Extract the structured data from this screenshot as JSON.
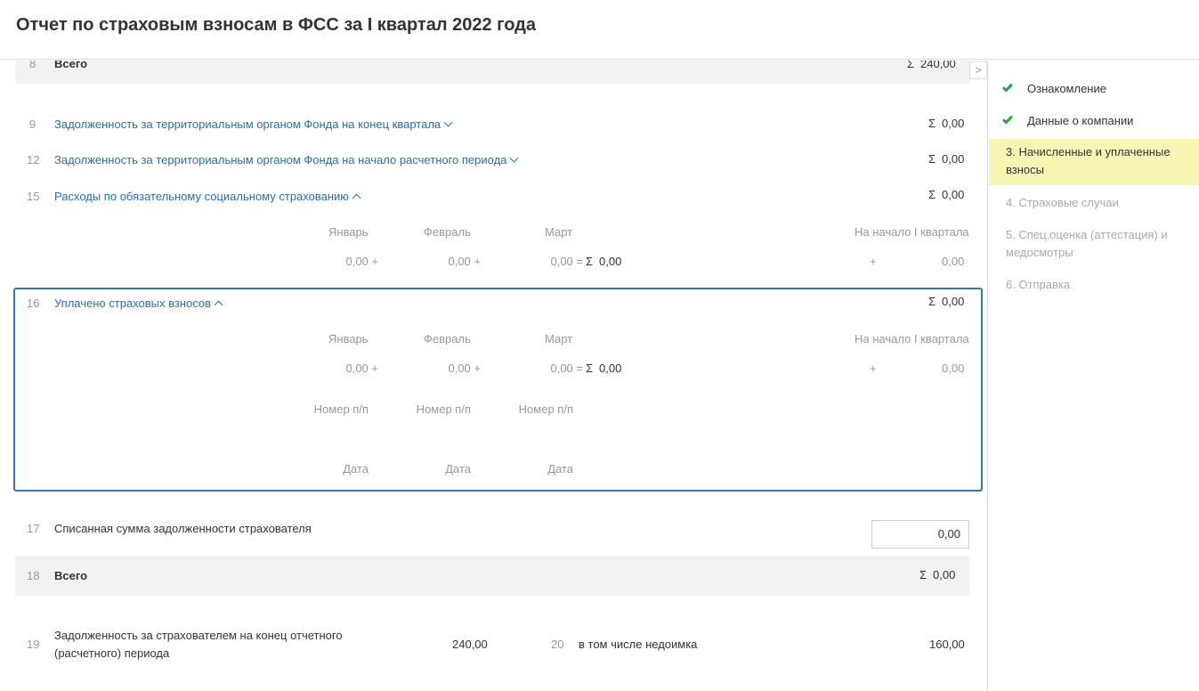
{
  "header": {
    "title": "Отчет по страховым взносам в ФСС за I квартал 2022 года"
  },
  "rows": {
    "r8": {
      "num": "8",
      "label": "Всего",
      "sigma": "Σ",
      "value": "240,00"
    },
    "r9": {
      "num": "9",
      "label": "Задолженность за территориальным органом Фонда на конец квартала",
      "sigma": "Σ",
      "value": "0,00"
    },
    "r12": {
      "num": "12",
      "label": "Задолженность за территориальным органом Фонда на начало расчетного периода",
      "sigma": "Σ",
      "value": "0,00"
    },
    "r15": {
      "num": "15",
      "label": "Расходы по обязательному социальному страхованию",
      "sigma": "Σ",
      "value": "0,00",
      "months": [
        "Январь",
        "Февраль",
        "Март"
      ],
      "start_label": "На начало I квартала",
      "jan": "0,00 +",
      "feb": "0,00 +",
      "mar": "0,00 =",
      "total_sigma": "Σ",
      "total": "0,00",
      "plus": "+",
      "start_value": "0,00"
    },
    "r16": {
      "num": "16",
      "label": "Уплачено страховых взносов",
      "sigma": "Σ",
      "value": "0,00",
      "months": [
        "Январь",
        "Февраль",
        "Март"
      ],
      "start_label": "На начало I квартала",
      "jan": "0,00 +",
      "feb": "0,00 +",
      "mar": "0,00 =",
      "total_sigma": "Σ",
      "total": "0,00",
      "plus": "+",
      "start_value": "0,00",
      "doc_num_label": "Номер п/п",
      "date_label": "Дата"
    },
    "r17": {
      "num": "17",
      "label": "Списанная сумма задолженности страхователя",
      "value": "0,00"
    },
    "r18": {
      "num": "18",
      "label": "Всего",
      "sigma": "Σ",
      "value": "0,00"
    },
    "r19": {
      "num": "19",
      "label_line1": "Задолженность за страхователем на конец отчетного",
      "label_line2": "(расчетного) периода",
      "value": "240,00"
    },
    "r20": {
      "num": "20",
      "label": "в том числе недоимка",
      "value": "160,00"
    }
  },
  "sidebar": {
    "toggle_glyph": ">",
    "steps": [
      {
        "label": "Ознакомление",
        "state": "done"
      },
      {
        "label": "Данные о компании",
        "state": "done"
      },
      {
        "label": "3.  Начисленные и уплаченные взносы",
        "state": "active"
      },
      {
        "label": "4.  Страховые случаи",
        "state": "pending"
      },
      {
        "label": "5.  Спец.оценка (аттестация) и медосмотры",
        "state": "pending"
      },
      {
        "label": "6.  Отправка",
        "state": "pending"
      }
    ]
  },
  "colors": {
    "link": "#2b6fa8",
    "check": "#2aa54b",
    "active_step_bg": "#f8f6b4",
    "focus_border": "#3a73ad",
    "band_bg": "#f2f2f2"
  },
  "icons": [
    "check-icon",
    "chevron-down-icon",
    "chevron-up-icon",
    "sigma-icon",
    "chevron-right-icon"
  ]
}
